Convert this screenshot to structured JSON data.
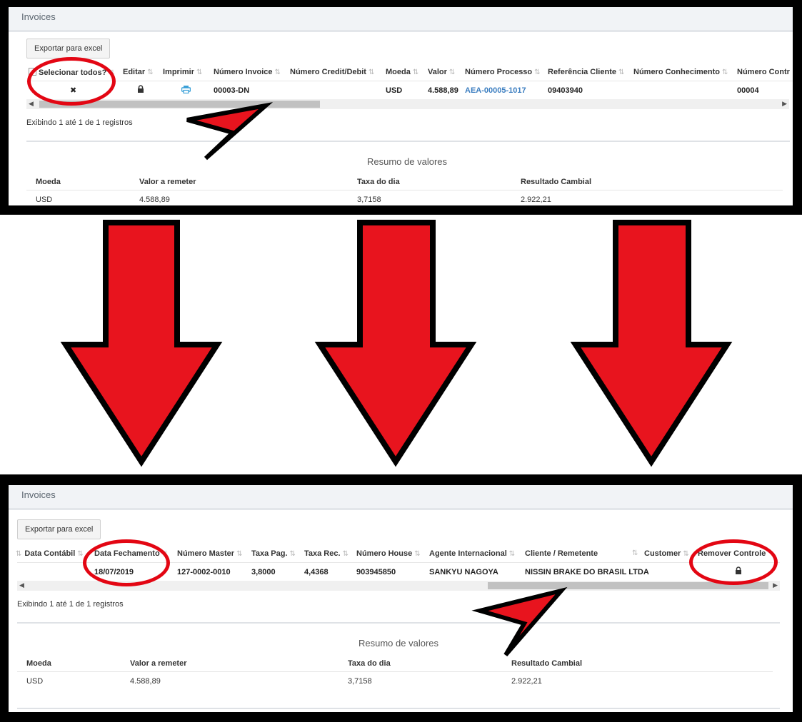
{
  "panel": {
    "title": "Invoices",
    "export_label": "Exportar para excel",
    "records_info": "Exibindo 1 até 1 de 1 registros",
    "summary_title": "Resumo de valores"
  },
  "top_table": {
    "headers": {
      "select_all": "Selecionar todos?",
      "edit": "Editar",
      "print": "Imprimir",
      "invoice_number": "Número Invoice",
      "credit_debit": "Número Credit/Debit",
      "currency": "Moeda",
      "value": "Valor",
      "process_number": "Número Processo",
      "client_reference": "Referência Cliente",
      "knowledge_number": "Número Conhecimento",
      "contr_number": "Número Contr"
    },
    "row": {
      "select": "✖",
      "invoice_number": "00003-DN",
      "currency": "USD",
      "value": "4.588,89",
      "process_number": "AEA-00005-1017",
      "client_reference": "09403940",
      "contr_number": "00004"
    }
  },
  "bottom_table": {
    "headers": {
      "data_contabil": "Data Contábil",
      "data_fechamento": "Data Fechamento",
      "numero_master": "Número Master",
      "taxa_pag": "Taxa Pag.",
      "taxa_rec": "Taxa Rec.",
      "numero_house": "Número House",
      "agente_internacional": "Agente Internacional",
      "cliente_remetente": "Cliente / Remetente",
      "customer": "Customer",
      "remover_controle": "Remover Controle"
    },
    "row": {
      "data_fechamento": "18/07/2019",
      "numero_master": "127-0002-0010",
      "taxa_pag": "3,8000",
      "taxa_rec": "4,4368",
      "numero_house": "903945850",
      "agente_internacional": "SANKYU NAGOYA",
      "cliente_remetente": "NISSIN BRAKE DO BRASIL LTDA"
    }
  },
  "summary": {
    "headers": {
      "moeda": "Moeda",
      "valor_remeter": "Valor a remeter",
      "taxa_dia": "Taxa do dia",
      "resultado_cambial": "Resultado Cambial"
    },
    "row": {
      "moeda": "USD",
      "valor_remeter": "4.588,89",
      "taxa_dia": "3,7158",
      "resultado_cambial": "2.922,21"
    }
  },
  "scroll": {
    "top_position": 0.0,
    "bottom_position": 1.0
  },
  "icons": {
    "sort": "sort-arrows-icon",
    "lock": "lock-icon",
    "print": "printer-icon",
    "close": "close-x-icon",
    "arrow_left": "scroll-left-arrow-icon",
    "arrow_right": "scroll-right-arrow-icon"
  },
  "colors": {
    "annotation_red": "#e30613",
    "link_blue": "#3c7ec0",
    "header_bg": "#f1f3f6"
  }
}
